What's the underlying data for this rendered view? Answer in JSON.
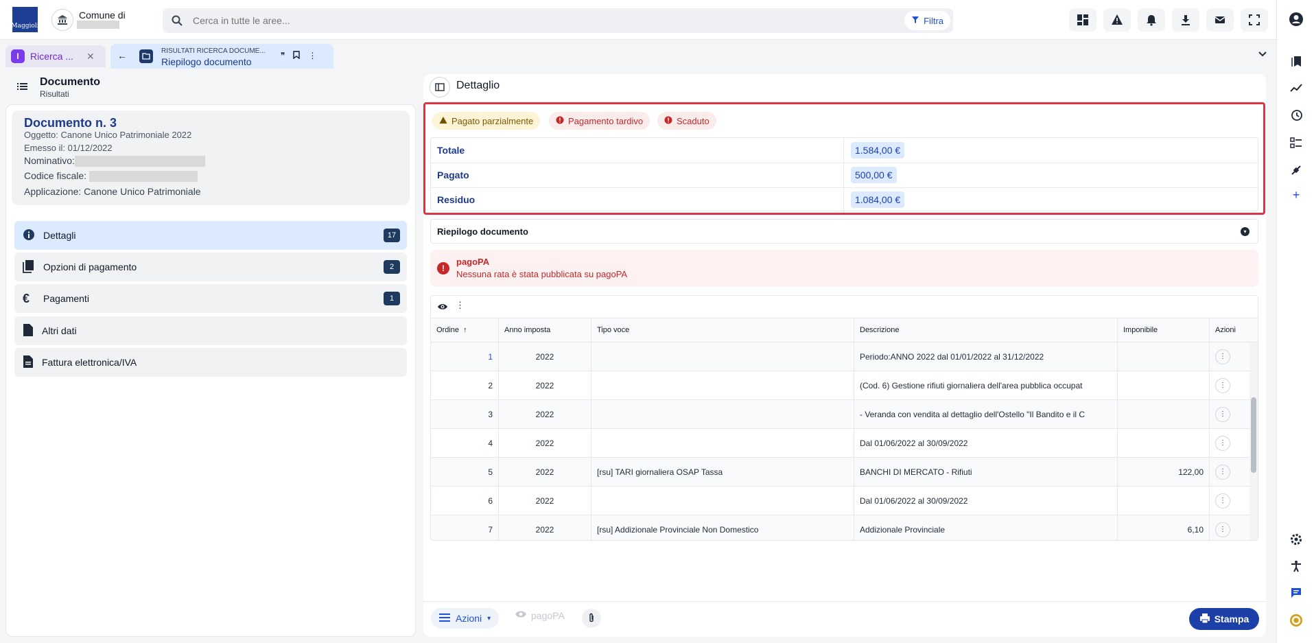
{
  "header": {
    "logo_text": "Maggioli",
    "comune_label": "Comune di",
    "search_placeholder": "Cerca in tutte le aree...",
    "filter_label": "Filtra"
  },
  "tabs": {
    "tab1": {
      "label": "Ricerca ...",
      "badge": "I"
    },
    "tab2": {
      "subtitle": "RISULTATI RICERCA DOCUME...",
      "title": "Riepilogo documento"
    }
  },
  "left": {
    "title": "Documento",
    "subtitle": "Risultati",
    "doc": {
      "title": "Documento n. 3",
      "oggetto": "Oggetto: Canone Unico Patrimoniale 2022",
      "emesso": "Emesso il: 01/12/2022",
      "nominativo_label": "Nominativo:",
      "cf_label": "Codice fiscale:",
      "applicazione": "Applicazione: Canone Unico Patrimoniale"
    },
    "menu": [
      {
        "label": "Dettagli",
        "count": "17"
      },
      {
        "label": "Opzioni di pagamento",
        "count": "2"
      },
      {
        "label": "Pagamenti",
        "count": "1"
      },
      {
        "label": "Altri dati",
        "count": ""
      },
      {
        "label": "Fattura elettronica/IVA",
        "count": ""
      }
    ]
  },
  "detail": {
    "title": "Dettaglio",
    "badges": {
      "warn": "Pagato parzialmente",
      "late": "Pagamento tardivo",
      "expired": "Scaduto"
    },
    "summary": [
      {
        "label": "Totale",
        "value": "1.584,00 €"
      },
      {
        "label": "Pagato",
        "value": "500,00 €"
      },
      {
        "label": "Residuo",
        "value": "1.084,00 €"
      }
    ],
    "riepilogo_label": "Riepilogo documento",
    "alert": {
      "title": "pagoPA",
      "text": "Nessuna rata è stata pubblicata su pagoPA"
    },
    "grid": {
      "columns": {
        "ordine": "Ordine",
        "anno": "Anno imposta",
        "tipo": "Tipo voce",
        "descrizione": "Descrizione",
        "imponibile": "Imponibile",
        "azioni": "Azioni"
      },
      "rows": [
        {
          "ordine": "1",
          "anno": "2022",
          "tipo": "",
          "descrizione": "Periodo:ANNO 2022 dal 01/01/2022 al 31/12/2022",
          "imponibile": ""
        },
        {
          "ordine": "2",
          "anno": "2022",
          "tipo": "",
          "descrizione": "(Cod. 6) Gestione rifiuti giornaliera dell'area pubblica occupat",
          "imponibile": ""
        },
        {
          "ordine": "3",
          "anno": "2022",
          "tipo": "",
          "descrizione": "- Veranda con vendita al dettaglio dell'Ostello \"Il Bandito e il C",
          "imponibile": ""
        },
        {
          "ordine": "4",
          "anno": "2022",
          "tipo": "",
          "descrizione": "Dal 01/06/2022 al 30/09/2022",
          "imponibile": ""
        },
        {
          "ordine": "5",
          "anno": "2022",
          "tipo": "[rsu] TARI giornaliera OSAP Tassa",
          "descrizione": "BANCHI DI MERCATO - Rifiuti",
          "imponibile": "122,00"
        },
        {
          "ordine": "6",
          "anno": "2022",
          "tipo": "",
          "descrizione": "Dal 01/06/2022 al 30/09/2022",
          "imponibile": ""
        },
        {
          "ordine": "7",
          "anno": "2022",
          "tipo": "[rsu] Addizionale Provinciale Non Domestico",
          "descrizione": "Addizionale Provinciale",
          "imponibile": "6,10"
        }
      ]
    }
  },
  "footer": {
    "azioni": "Azioni",
    "pagopa": "pagoPA",
    "stampa": "Stampa"
  },
  "colors": {
    "primary": "#1d3fa8",
    "highlight_border": "#dc3545",
    "warn_bg": "#fdf3d6",
    "error": "#c62828"
  }
}
